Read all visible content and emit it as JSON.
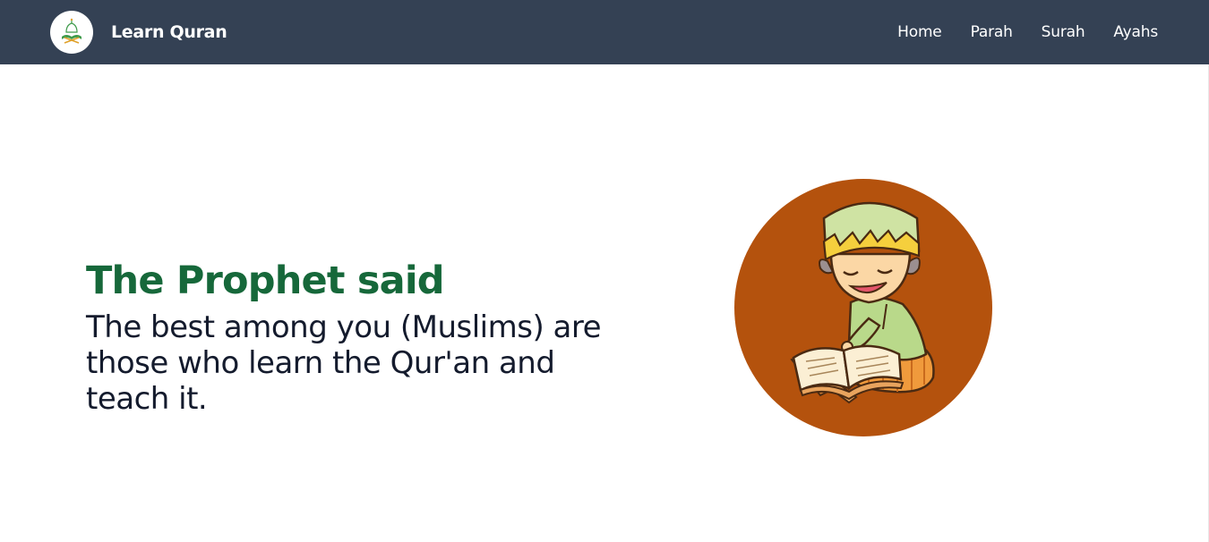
{
  "header": {
    "brand_name": "Learn Quran",
    "logo_icon": "mosque-quran-logo-icon",
    "nav": [
      {
        "label": "Home"
      },
      {
        "label": "Parah"
      },
      {
        "label": "Surah"
      },
      {
        "label": "Ayahs"
      }
    ]
  },
  "hero": {
    "title": "The Prophet said",
    "quote": "The best among you (Muslims) are those who learn the Qur'an and teach it.",
    "illustration": "boy-reading-quran-illustration"
  },
  "colors": {
    "navbar_bg": "#344154",
    "title_green": "#16683a",
    "quote_text": "#141b2d",
    "circle_brown": "#b4520d"
  }
}
